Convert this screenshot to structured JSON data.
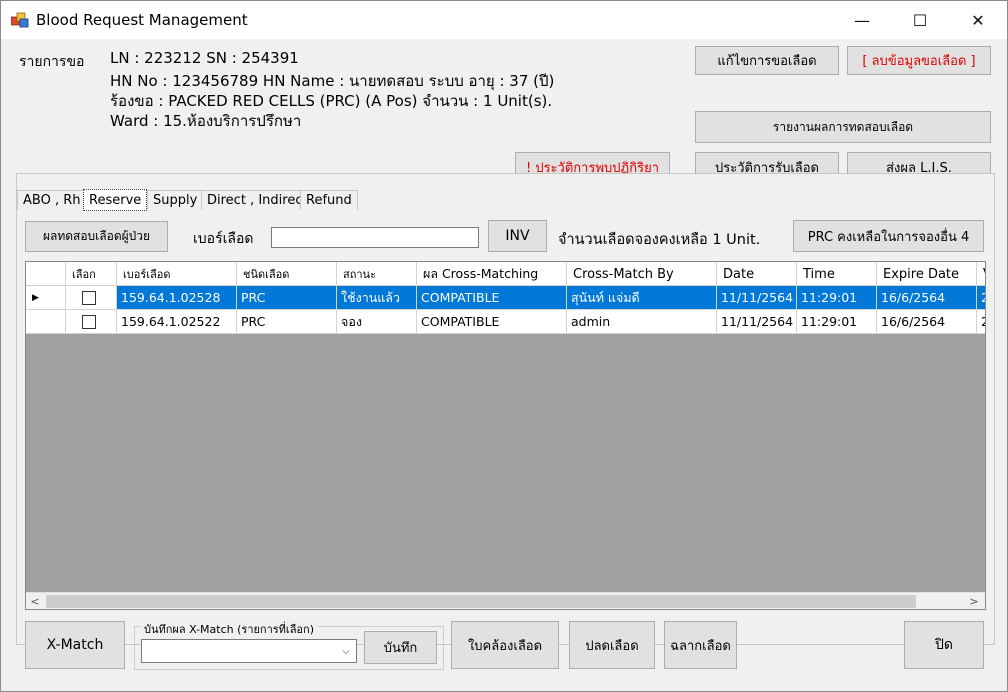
{
  "window": {
    "title": "Blood Request Management",
    "minimize": "—",
    "maximize": "☐",
    "close": "✕"
  },
  "request": {
    "section_label": "รายการขอ",
    "ln_sn": "LN : 223212   SN : 254391",
    "hn_line": "HN No : 123456789    HN Name : นายทดสอบ  ระบบ     อายุ : 37 (ปี)",
    "request_line": "ร้องขอ : PACKED RED CELLS (PRC)     (A Pos)     จำนวน : 1 Unit(s).",
    "ward_line": "Ward : 15.ห้องบริการปรึกษา"
  },
  "buttons": {
    "edit_request": "แก้ไขการขอเลือด",
    "delete_request": "[ ลบข้อมูลขอเลือด ]",
    "test_report": "รายงานผลการทดสอบเลือด",
    "reaction_history": "! ประวัติการพบปฏิกิริยา",
    "receive_history": "ประวัติการรับเลือด",
    "send_lis": "ส่งผล L.I.S.",
    "patient_test": "ผลทดสอบเลือดผู้ป่วย",
    "inv": "INV",
    "prc_remaining": "PRC คงเหลือในการจองอื่น 4",
    "xmatch": "X-Match",
    "save": "บันทึก",
    "blood_slip": "ใบคล้องเลือด",
    "release": "ปลดเลือด",
    "label": "ฉลากเลือด",
    "close": "ปิด"
  },
  "tabs": [
    {
      "label": "ABO , Rh"
    },
    {
      "label": "Reserve"
    },
    {
      "label": "Supply"
    },
    {
      "label": "Direct , Indirect"
    },
    {
      "label": "Refund"
    }
  ],
  "reserve": {
    "blood_no_label": "เบอร์เลือด",
    "blood_no_value": "",
    "remaining_text": "จำนวนเลือดจองคงเหลือ 1 Unit."
  },
  "grid": {
    "columns": [
      "เลือก",
      "เบอร์เลือด",
      "ชนิดเลือด",
      "สถานะ",
      "ผล Cross-Matching",
      "Cross-Match By",
      "Date",
      "Time",
      "Expire Date",
      "V"
    ],
    "rows": [
      {
        "selected_row": true,
        "checked": false,
        "blood_no": "159.64.1.02528",
        "type": "PRC",
        "status": "ใช้งานแล้ว",
        "result": "COMPATIBLE",
        "by": "สุนันท์ แจ่มดี",
        "date": "11/11/2564",
        "time": "11:29:01",
        "expire": "16/6/2564",
        "extra": "2"
      },
      {
        "selected_row": false,
        "checked": false,
        "blood_no": "159.64.1.02522",
        "type": "PRC",
        "status": "จอง",
        "result": "COMPATIBLE",
        "by": "admin",
        "date": "11/11/2564",
        "time": "11:29:01",
        "expire": "16/6/2564",
        "extra": "2"
      }
    ],
    "row_marker": "▶",
    "scroll_left": "<",
    "scroll_right": ">"
  },
  "xmatch_group": {
    "title": "บันทึกผล X-Match (รายการที่เลือก)",
    "combo_value": "",
    "combo_arrow": "⌵"
  },
  "colors": {
    "selection": "#0078d7",
    "danger_text": "#e00000",
    "grid_empty": "#a0a0a0"
  }
}
